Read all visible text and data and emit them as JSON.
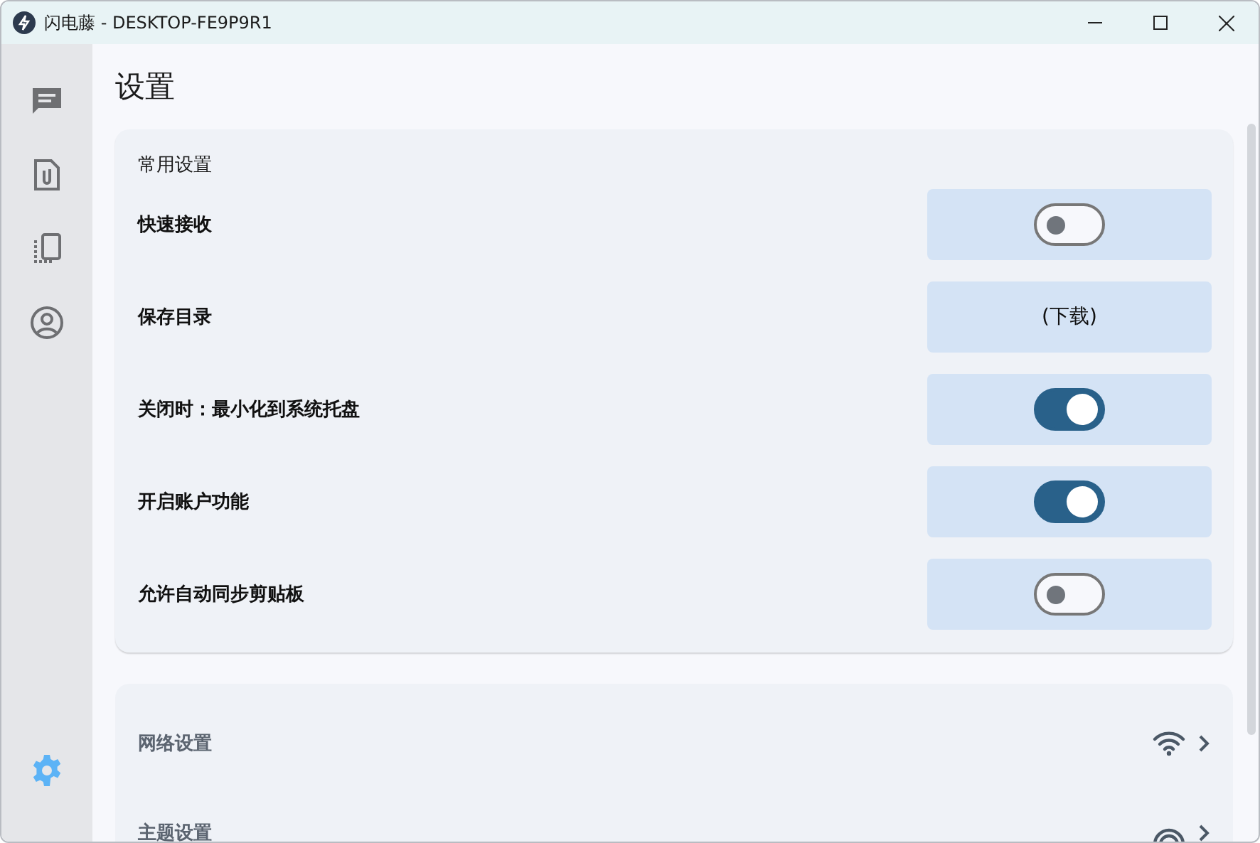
{
  "window": {
    "title": "闪电藤 - DESKTOP-FE9P9R1"
  },
  "sidebar": {
    "items": [
      {
        "selected": false
      },
      {
        "selected": false
      },
      {
        "selected": false
      },
      {
        "selected": false
      }
    ],
    "bottom_item": {
      "selected": true
    }
  },
  "page_title": "设置",
  "general": {
    "title": "常用设置",
    "rows": [
      {
        "kind": "toggle",
        "label": "快速接收",
        "on": false
      },
      {
        "kind": "value",
        "label": "保存目录",
        "value": "(下载)"
      },
      {
        "kind": "toggle",
        "label": "关闭时：最小化到系统托盘",
        "on": true
      },
      {
        "kind": "toggle",
        "label": "开启账户功能",
        "on": true
      },
      {
        "kind": "toggle",
        "label": "允许自动同步剪贴板",
        "on": false
      }
    ]
  },
  "more": {
    "rows": [
      {
        "label": "网络设置"
      },
      {
        "label": "主题设置"
      }
    ]
  }
}
